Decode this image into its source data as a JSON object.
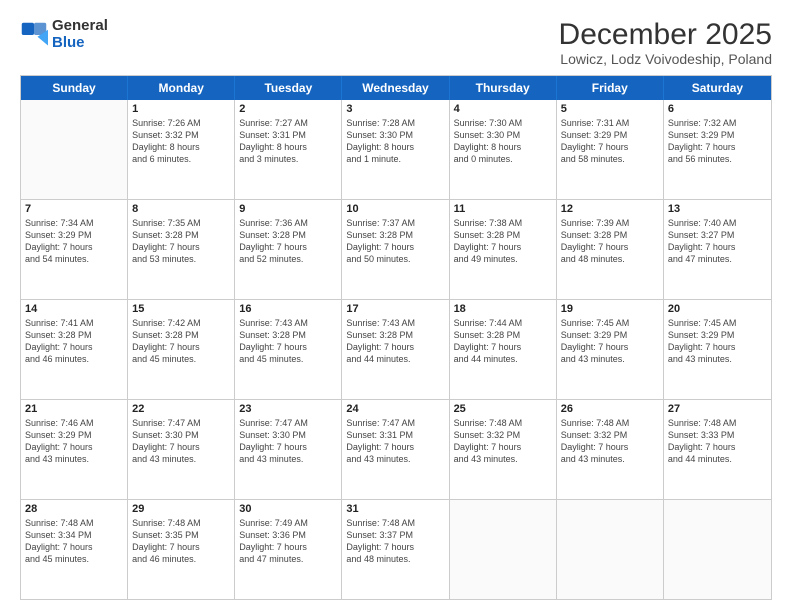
{
  "logo": {
    "general": "General",
    "blue": "Blue"
  },
  "title": "December 2025",
  "subtitle": "Lowicz, Lodz Voivodeship, Poland",
  "calendar": {
    "headers": [
      "Sunday",
      "Monday",
      "Tuesday",
      "Wednesday",
      "Thursday",
      "Friday",
      "Saturday"
    ],
    "weeks": [
      [
        {
          "day": "",
          "lines": []
        },
        {
          "day": "1",
          "lines": [
            "Sunrise: 7:26 AM",
            "Sunset: 3:32 PM",
            "Daylight: 8 hours",
            "and 6 minutes."
          ]
        },
        {
          "day": "2",
          "lines": [
            "Sunrise: 7:27 AM",
            "Sunset: 3:31 PM",
            "Daylight: 8 hours",
            "and 3 minutes."
          ]
        },
        {
          "day": "3",
          "lines": [
            "Sunrise: 7:28 AM",
            "Sunset: 3:30 PM",
            "Daylight: 8 hours",
            "and 1 minute."
          ]
        },
        {
          "day": "4",
          "lines": [
            "Sunrise: 7:30 AM",
            "Sunset: 3:30 PM",
            "Daylight: 8 hours",
            "and 0 minutes."
          ]
        },
        {
          "day": "5",
          "lines": [
            "Sunrise: 7:31 AM",
            "Sunset: 3:29 PM",
            "Daylight: 7 hours",
            "and 58 minutes."
          ]
        },
        {
          "day": "6",
          "lines": [
            "Sunrise: 7:32 AM",
            "Sunset: 3:29 PM",
            "Daylight: 7 hours",
            "and 56 minutes."
          ]
        }
      ],
      [
        {
          "day": "7",
          "lines": [
            "Sunrise: 7:34 AM",
            "Sunset: 3:29 PM",
            "Daylight: 7 hours",
            "and 54 minutes."
          ]
        },
        {
          "day": "8",
          "lines": [
            "Sunrise: 7:35 AM",
            "Sunset: 3:28 PM",
            "Daylight: 7 hours",
            "and 53 minutes."
          ]
        },
        {
          "day": "9",
          "lines": [
            "Sunrise: 7:36 AM",
            "Sunset: 3:28 PM",
            "Daylight: 7 hours",
            "and 52 minutes."
          ]
        },
        {
          "day": "10",
          "lines": [
            "Sunrise: 7:37 AM",
            "Sunset: 3:28 PM",
            "Daylight: 7 hours",
            "and 50 minutes."
          ]
        },
        {
          "day": "11",
          "lines": [
            "Sunrise: 7:38 AM",
            "Sunset: 3:28 PM",
            "Daylight: 7 hours",
            "and 49 minutes."
          ]
        },
        {
          "day": "12",
          "lines": [
            "Sunrise: 7:39 AM",
            "Sunset: 3:28 PM",
            "Daylight: 7 hours",
            "and 48 minutes."
          ]
        },
        {
          "day": "13",
          "lines": [
            "Sunrise: 7:40 AM",
            "Sunset: 3:27 PM",
            "Daylight: 7 hours",
            "and 47 minutes."
          ]
        }
      ],
      [
        {
          "day": "14",
          "lines": [
            "Sunrise: 7:41 AM",
            "Sunset: 3:28 PM",
            "Daylight: 7 hours",
            "and 46 minutes."
          ]
        },
        {
          "day": "15",
          "lines": [
            "Sunrise: 7:42 AM",
            "Sunset: 3:28 PM",
            "Daylight: 7 hours",
            "and 45 minutes."
          ]
        },
        {
          "day": "16",
          "lines": [
            "Sunrise: 7:43 AM",
            "Sunset: 3:28 PM",
            "Daylight: 7 hours",
            "and 45 minutes."
          ]
        },
        {
          "day": "17",
          "lines": [
            "Sunrise: 7:43 AM",
            "Sunset: 3:28 PM",
            "Daylight: 7 hours",
            "and 44 minutes."
          ]
        },
        {
          "day": "18",
          "lines": [
            "Sunrise: 7:44 AM",
            "Sunset: 3:28 PM",
            "Daylight: 7 hours",
            "and 44 minutes."
          ]
        },
        {
          "day": "19",
          "lines": [
            "Sunrise: 7:45 AM",
            "Sunset: 3:29 PM",
            "Daylight: 7 hours",
            "and 43 minutes."
          ]
        },
        {
          "day": "20",
          "lines": [
            "Sunrise: 7:45 AM",
            "Sunset: 3:29 PM",
            "Daylight: 7 hours",
            "and 43 minutes."
          ]
        }
      ],
      [
        {
          "day": "21",
          "lines": [
            "Sunrise: 7:46 AM",
            "Sunset: 3:29 PM",
            "Daylight: 7 hours",
            "and 43 minutes."
          ]
        },
        {
          "day": "22",
          "lines": [
            "Sunrise: 7:47 AM",
            "Sunset: 3:30 PM",
            "Daylight: 7 hours",
            "and 43 minutes."
          ]
        },
        {
          "day": "23",
          "lines": [
            "Sunrise: 7:47 AM",
            "Sunset: 3:30 PM",
            "Daylight: 7 hours",
            "and 43 minutes."
          ]
        },
        {
          "day": "24",
          "lines": [
            "Sunrise: 7:47 AM",
            "Sunset: 3:31 PM",
            "Daylight: 7 hours",
            "and 43 minutes."
          ]
        },
        {
          "day": "25",
          "lines": [
            "Sunrise: 7:48 AM",
            "Sunset: 3:32 PM",
            "Daylight: 7 hours",
            "and 43 minutes."
          ]
        },
        {
          "day": "26",
          "lines": [
            "Sunrise: 7:48 AM",
            "Sunset: 3:32 PM",
            "Daylight: 7 hours",
            "and 43 minutes."
          ]
        },
        {
          "day": "27",
          "lines": [
            "Sunrise: 7:48 AM",
            "Sunset: 3:33 PM",
            "Daylight: 7 hours",
            "and 44 minutes."
          ]
        }
      ],
      [
        {
          "day": "28",
          "lines": [
            "Sunrise: 7:48 AM",
            "Sunset: 3:34 PM",
            "Daylight: 7 hours",
            "and 45 minutes."
          ]
        },
        {
          "day": "29",
          "lines": [
            "Sunrise: 7:48 AM",
            "Sunset: 3:35 PM",
            "Daylight: 7 hours",
            "and 46 minutes."
          ]
        },
        {
          "day": "30",
          "lines": [
            "Sunrise: 7:49 AM",
            "Sunset: 3:36 PM",
            "Daylight: 7 hours",
            "and 47 minutes."
          ]
        },
        {
          "day": "31",
          "lines": [
            "Sunrise: 7:48 AM",
            "Sunset: 3:37 PM",
            "Daylight: 7 hours",
            "and 48 minutes."
          ]
        },
        {
          "day": "",
          "lines": []
        },
        {
          "day": "",
          "lines": []
        },
        {
          "day": "",
          "lines": []
        }
      ]
    ]
  }
}
